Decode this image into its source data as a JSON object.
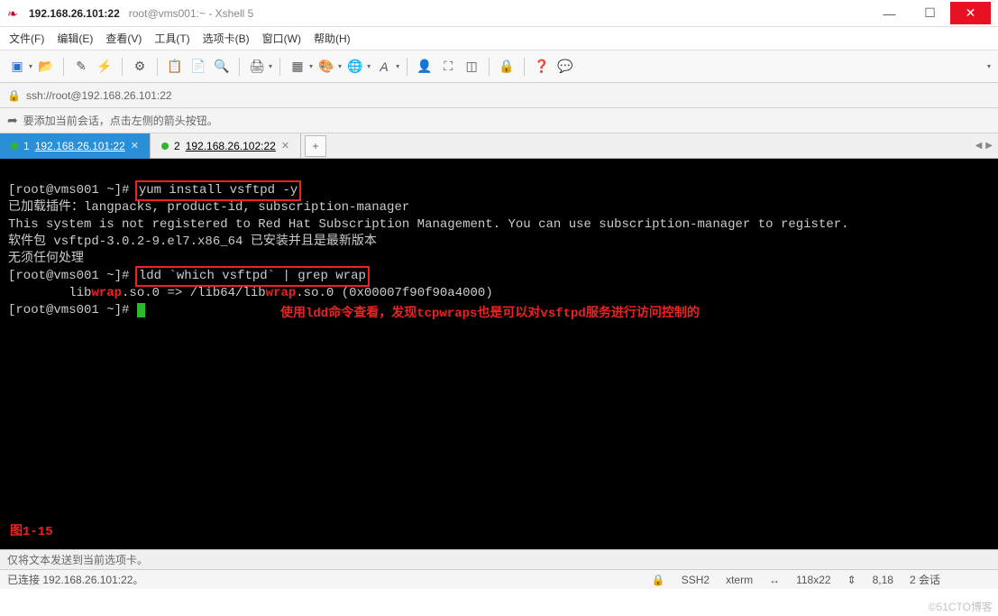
{
  "titlebar": {
    "ip": "192.168.26.101:22",
    "subtitle": "root@vms001:~ - Xshell 5"
  },
  "menu": {
    "file": "文件(F)",
    "edit": "编辑(E)",
    "view": "查看(V)",
    "tools": "工具(T)",
    "tabs": "选项卡(B)",
    "window": "窗口(W)",
    "help": "帮助(H)"
  },
  "address": {
    "url": "ssh://root@192.168.26.101:22"
  },
  "hint": {
    "text": "要添加当前会话，点击左侧的箭头按钮。"
  },
  "tabs": {
    "items": [
      {
        "index": "1",
        "label": "192.168.26.101:22",
        "active": true
      },
      {
        "index": "2",
        "label": "192.168.26.102:22",
        "active": false
      }
    ]
  },
  "terminal": {
    "prompt1": "[root@vms001 ~]# ",
    "cmd1": "yum install vsftpd -y",
    "line2": "已加载插件：langpacks, product-id, subscription-manager",
    "line3": "This system is not registered to Red Hat Subscription Management. You can use subscription-manager to register.",
    "line4": "软件包 vsftpd-3.0.2-9.el7.x86_64 已安装并且是最新版本",
    "line5": "无须任何处理",
    "prompt2": "[root@vms001 ~]# ",
    "cmd2": "ldd `which vsftpd` | grep wrap",
    "line7_a": "        lib",
    "line7_wrap": "wrap",
    "line7_b": ".so.0 => /lib64/lib",
    "line7_c": ".so.0 (0x00007f90f90a4000)",
    "prompt3": "[root@vms001 ~]# ",
    "annotation": "使用ldd命令查看，发现tcpwraps也是可以对vsftpd服务进行访问控制的",
    "figure": "图1-15"
  },
  "status_upper": "仅将文本发送到当前选项卡。",
  "status": {
    "conn": "已连接 192.168.26.101:22。",
    "ssh": "SSH2",
    "term": "xterm",
    "size": "118x22",
    "pos": "8,18",
    "sessions": "2 会话"
  },
  "watermark": "©51CTO博客"
}
